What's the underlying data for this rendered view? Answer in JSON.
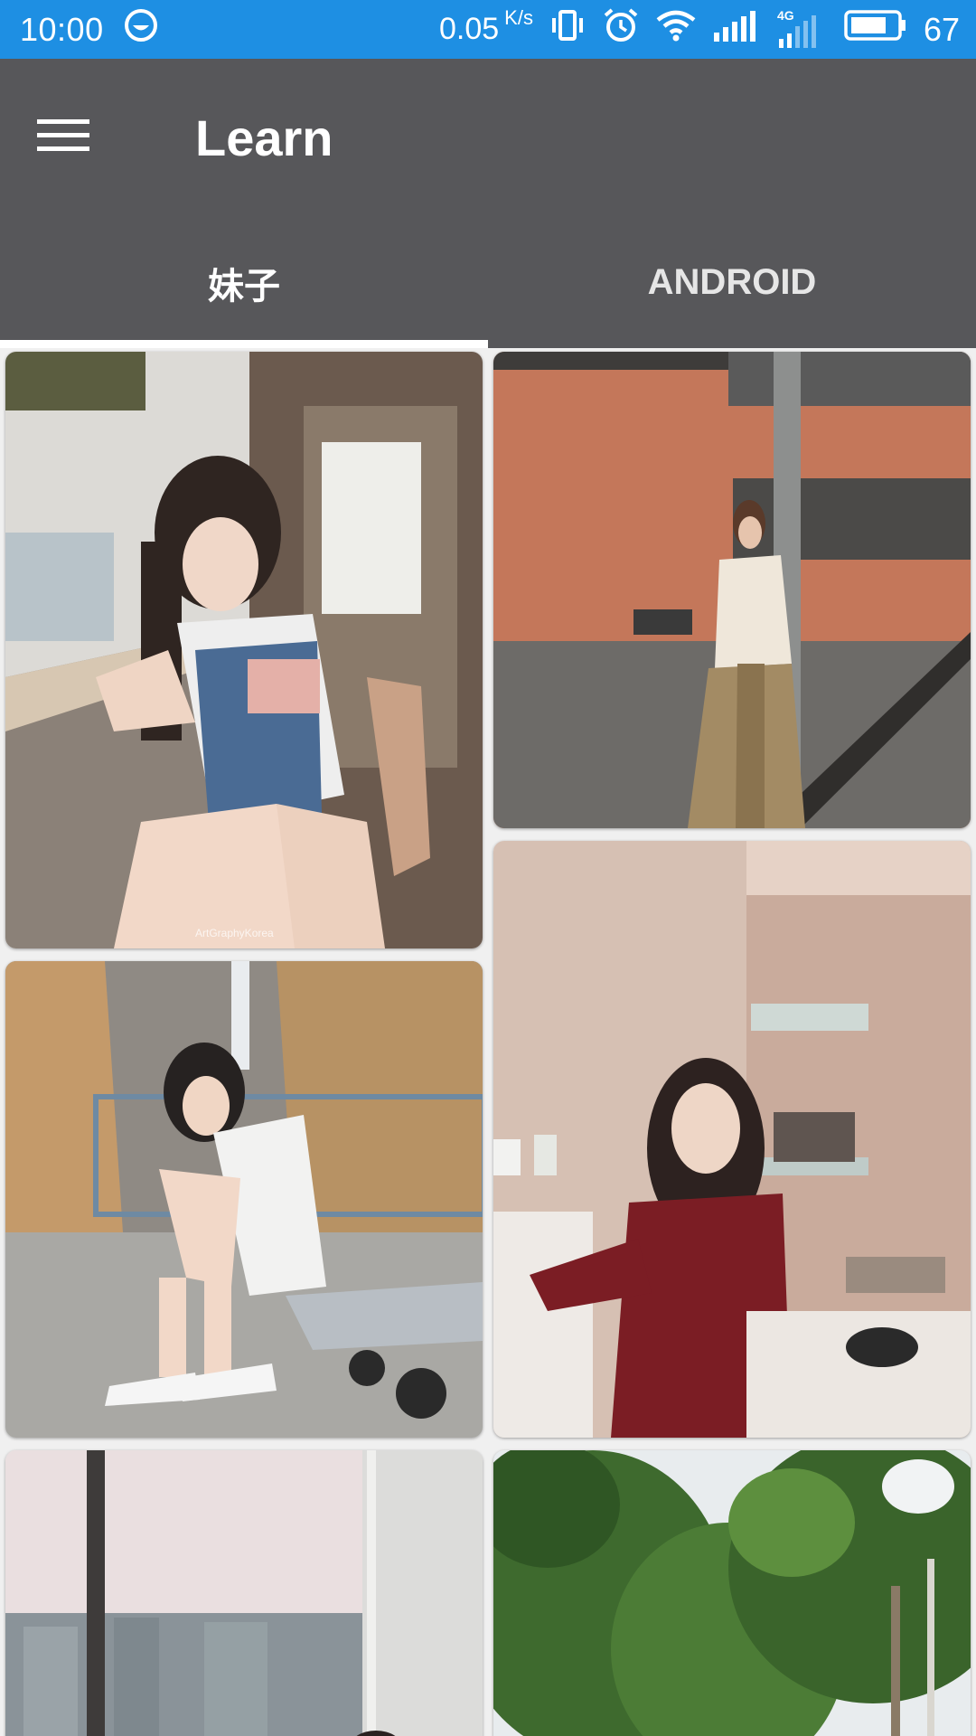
{
  "status_bar": {
    "time": "10:00",
    "speed_value": "0.05",
    "speed_unit": "K/s",
    "network_type": "4G",
    "battery_percent": "67",
    "background_color": "#1e8fe3",
    "icons": [
      "assistant-icon",
      "vibrate-icon",
      "alarm-icon",
      "wifi-icon",
      "signal-icon",
      "signal-4g-icon",
      "battery-icon"
    ]
  },
  "app_bar": {
    "title": "Learn",
    "background_color": "#57575a",
    "menu_icon": "hamburger-menu-icon"
  },
  "tabs": [
    {
      "label": "妹子",
      "selected": true
    },
    {
      "label": "ANDROID",
      "selected": false
    }
  ],
  "gallery": {
    "items": [
      {
        "caption": "ArtGraphyKorea"
      },
      {
        "caption": ""
      },
      {
        "caption": ""
      },
      {
        "caption": ""
      },
      {
        "caption": ""
      },
      {
        "caption": ""
      }
    ]
  }
}
